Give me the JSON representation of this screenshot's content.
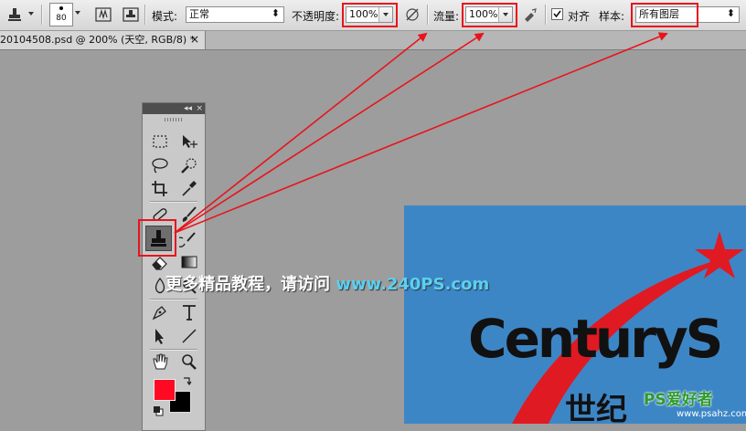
{
  "options_bar": {
    "brush_size": "80",
    "mode_label": "模式:",
    "mode_value": "正常",
    "opacity_label": "不透明度:",
    "opacity_value": "100%",
    "flow_label": "流量:",
    "flow_value": "100%",
    "align_label": "对齐",
    "align_checked": true,
    "sample_label": "样本:",
    "sample_value": "所有图层"
  },
  "document_tab": {
    "title": "20104508.psd @ 200% (天空, RGB/8) *",
    "close": "×"
  },
  "toolbox": {
    "collapse_glyph": "◂◂",
    "close_glyph": "×",
    "tools": [
      "rect-marquee",
      "move",
      "lasso",
      "quick-select",
      "crop",
      "eyedropper",
      "spot-healing",
      "brush",
      "clone-stamp",
      "history-brush",
      "eraser",
      "gradient",
      "blur",
      "dodge",
      "pen",
      "type",
      "path-select",
      "line",
      "hand",
      "zoom"
    ],
    "selected_tool": "clone-stamp",
    "foreground_color": "#ff0a22",
    "background_color": "#000000"
  },
  "overlay": {
    "watermark_text": "更多精品教程，请访问",
    "watermark_url": "www.240PS.com"
  },
  "canvas": {
    "logo_text": "CenturyS",
    "chinese_text": "世纪",
    "corner_mark": "PS爱好者",
    "corner_url": "www.psahz.com"
  },
  "colors": {
    "annotation_red": "#e8141c",
    "canvas_blue": "#3d86c6",
    "workspace_gray": "#9d9d9d"
  }
}
